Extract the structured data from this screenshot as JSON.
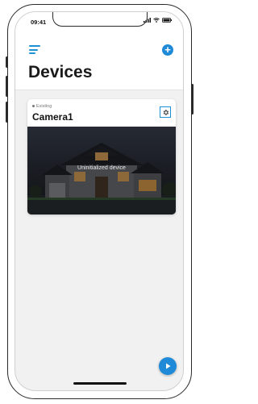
{
  "status_bar": {
    "time": "09:41"
  },
  "header": {
    "title": "Devices"
  },
  "device_card": {
    "state_label": "Existing",
    "name": "Camera1",
    "preview_message": "Uninitialized device"
  },
  "colors": {
    "accent": "#1f8ad7",
    "menu": "#1e90d6",
    "screen_bg": "#f1f1f1"
  },
  "icons": {
    "menu": "hamburger-menu-icon",
    "add": "plus-circle-icon",
    "settings": "gear-icon",
    "play": "play-icon"
  }
}
